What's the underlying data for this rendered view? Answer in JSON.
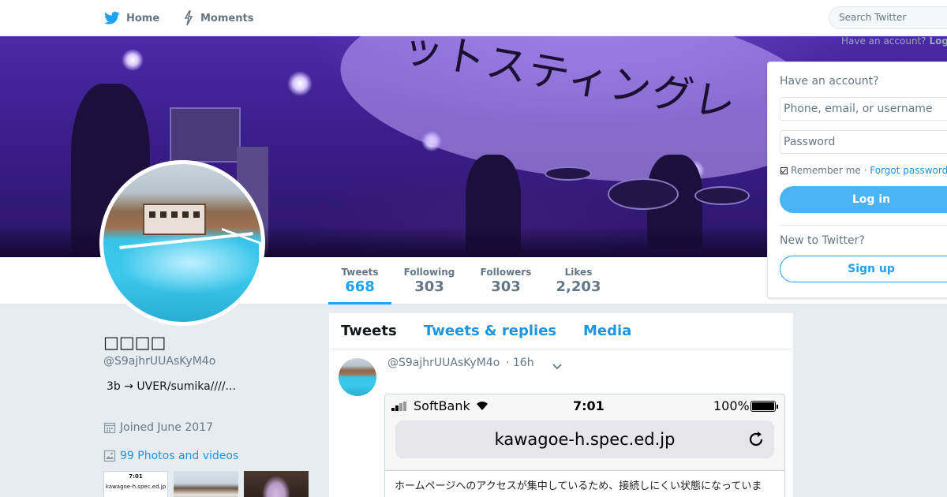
{
  "nav": {
    "home_label": "Home",
    "moments_label": "Moments",
    "search_placeholder": "Search Twitter",
    "have_account_text": "Have an account?",
    "login_link": "Log in"
  },
  "banner": {
    "sign_text": "ットスティングレ"
  },
  "profile": {
    "name": "□□□□",
    "handle": "@S9ajhrUUAsKyM4o",
    "bio": "3b → UVER/sumika////...",
    "joined": "Joined June 2017",
    "photos_link": "99 Photos and videos",
    "thumb1_time": "7:01",
    "thumb1_url": "kawagoe-h.spec.ed.jp"
  },
  "stats": [
    {
      "label": "Tweets",
      "value": "668"
    },
    {
      "label": "Following",
      "value": "303"
    },
    {
      "label": "Followers",
      "value": "303"
    },
    {
      "label": "Likes",
      "value": "2,203"
    }
  ],
  "timeline": {
    "tabs": [
      "Tweets",
      "Tweets & replies",
      "Media"
    ],
    "tweet": {
      "handle": "@S9ajhrUUAsKyM4o",
      "time": "· 16h",
      "screenshot": {
        "carrier": "SoftBank",
        "clock": "7:01",
        "battery": "100%",
        "url": "kawagoe-h.spec.ed.jp",
        "page_text": "ホームページへのアクセスが集中しているため、接続しにくい状態になっていま"
      }
    }
  },
  "login": {
    "title": "Have an account?",
    "username_placeholder": "Phone, email, or username",
    "password_placeholder": "Password",
    "remember": "Remember me",
    "separator": " · ",
    "forgot": "Forgot password?",
    "login_button": "Log in",
    "new_text": "New to Twitter?",
    "signup_button": "Sign up"
  },
  "colors": {
    "accent": "#1da1f2",
    "link": "#1b95e0",
    "background": "#e6ecf0"
  }
}
